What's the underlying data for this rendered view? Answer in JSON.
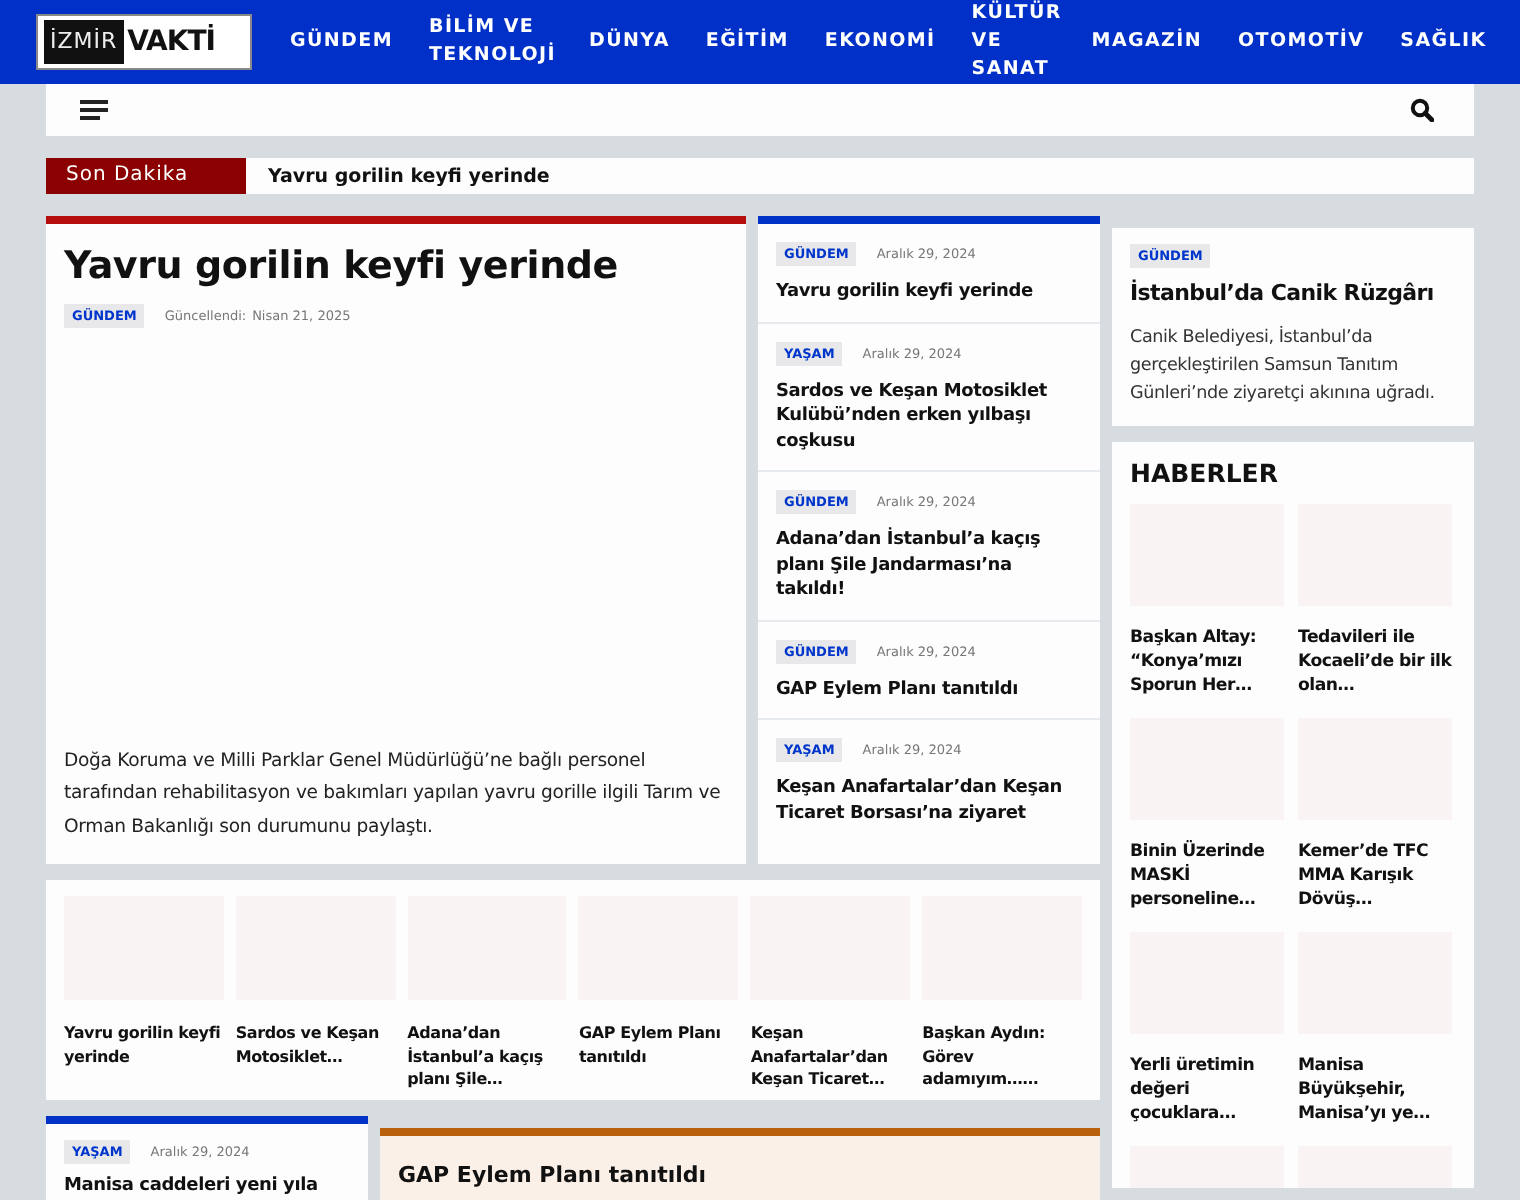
{
  "logo": {
    "left": "İZMİR",
    "right": "VAKTİ"
  },
  "nav": [
    "GÜNDEM",
    "BİLİM VE TEKNOLOJİ",
    "DÜNYA",
    "EĞİTİM",
    "EKONOMİ",
    "KÜLTÜR VE SANAT",
    "MAGAZİN",
    "OTOMOTİV",
    "SAĞLIK"
  ],
  "ticker": {
    "label": "Son Dakika",
    "headline": "Yavru gorilin keyfi yerinde"
  },
  "featured": {
    "title": "Yavru gorilin keyfi yerinde",
    "category": "GÜNDEM",
    "updated_label": "Güncellendi:",
    "date": "Nisan 21, 2025",
    "summary": "Doğa Koruma ve Milli Parklar Genel Müdürlüğü’ne bağlı personel tarafından rehabilitasyon ve bakımları yapılan yavru gorille ilgili Tarım ve Orman Bakanlığı son durumunu paylaştı."
  },
  "latest": [
    {
      "category": "GÜNDEM",
      "date": "Aralık 29, 2024",
      "title": "Yavru gorilin keyfi yerinde"
    },
    {
      "category": "YAŞAM",
      "date": "Aralık 29, 2024",
      "title": "Sardos ve Keşan Motosiklet Kulübü’nden erken yılbaşı coşkusu"
    },
    {
      "category": "GÜNDEM",
      "date": "Aralık 29, 2024",
      "title": "Adana’dan İstanbul’a kaçış planı Şile Jandarması’na takıldı!"
    },
    {
      "category": "GÜNDEM",
      "date": "Aralık 29, 2024",
      "title": "GAP Eylem Planı tanıtıldı"
    },
    {
      "category": "YAŞAM",
      "date": "Aralık 29, 2024",
      "title": "Keşan Anafartalar’dan Keşan Ticaret Borsası’na ziyaret"
    }
  ],
  "side_story": {
    "category": "GÜNDEM",
    "title": "İstanbul’da Canik Rüzgârı",
    "summary": "Canik Belediyesi, İstanbul’da gerçekleştirilen Samsun Tanıtım Günleri’nde ziyaretçi akınına uğradı."
  },
  "haberler": {
    "title": "HABERLER",
    "items": [
      "Başkan Altay: “Konya’mızı Sporun Her…",
      "Tedavileri ile Kocaeli’de bir ilk olan…",
      "Binin Üzerinde MASKİ personeline…",
      "Kemer’de TFC MMA Karışık Dövüş…",
      "Yerli üretimin değeri çocuklara…",
      "Manisa Büyükşehir, Manisa’yı ye…"
    ]
  },
  "carousel": [
    "Yavru gorilin keyfi yerinde",
    "Sardos ve Keşan Motosiklet…",
    "Adana’dan İstanbul’a kaçış planı Şile…",
    "GAP Eylem Planı tanıtıldı",
    "Keşan Anafartalar’dan Keşan Ticaret…",
    "Başkan Aydın: Görev adamıyım……"
  ],
  "bottom_left": {
    "category": "YAŞAM",
    "date": "Aralık 29, 2024",
    "title": "Manisa caddeleri yeni yıla"
  },
  "bottom_right": {
    "title": "GAP Eylem Planı tanıtıldı"
  }
}
